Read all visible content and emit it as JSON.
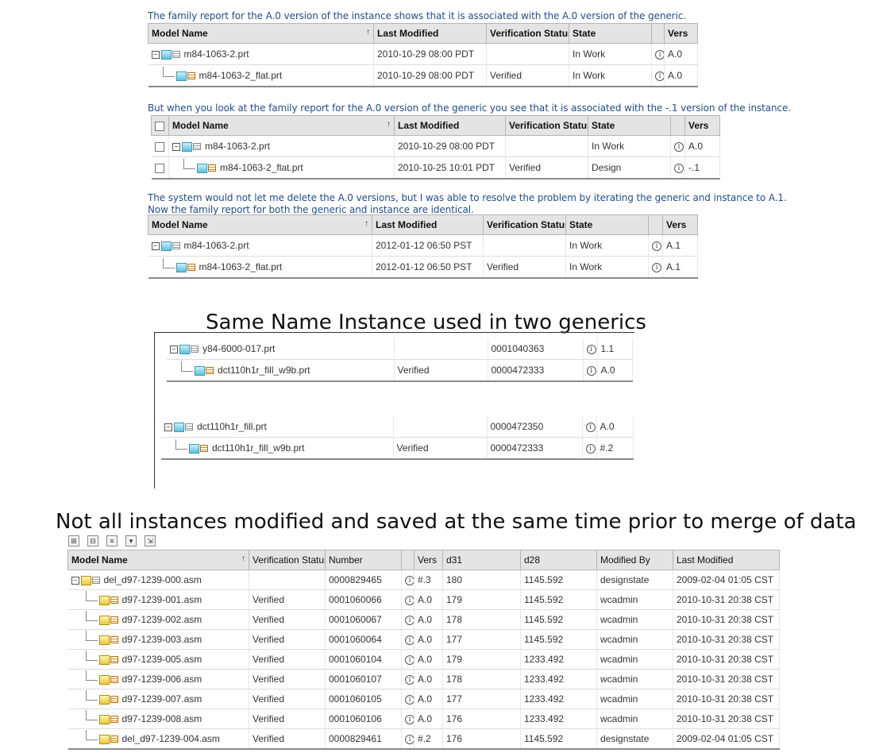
{
  "caption1": "The family report for the A.0 version of the instance shows that it is associated with the A.0 version of the generic.",
  "caption2": "But when you look at the family report for the A.0 version of the generic you see that it is associated with the -.1 version of the instance.",
  "caption3a": "The system would not let me delete the A.0 versions, but I was able to resolve the problem by iterating the generic and instance to A.1.",
  "caption3b": "Now the family report for both the generic and instance are identical.",
  "title_same_name": "Same Name Instance used in two generics",
  "title_not_all": "Not all instances modified and saved at the same time prior to merge of data",
  "columns_a": [
    "Model Name",
    "Last Modified",
    "Verification Status",
    "State",
    "",
    "Vers"
  ],
  "table1": [
    {
      "name": "m84-1063-2.prt",
      "modified": "2010-10-29 08:00 PDT",
      "verif": "",
      "state": "In Work",
      "vers": "A.0"
    },
    {
      "name": "m84-1063-2_flat.prt",
      "modified": "2010-10-29 08:00 PDT",
      "verif": "Verified",
      "state": "In Work",
      "vers": "A.0"
    }
  ],
  "table2": [
    {
      "name": "m84-1063-2.prt",
      "modified": "2010-10-29 08:00 PDT",
      "verif": "",
      "state": "In Work",
      "vers": "A.0"
    },
    {
      "name": "m84-1063-2_flat.prt",
      "modified": "2010-10-25 10:01 PDT",
      "verif": "Verified",
      "state": "Design",
      "vers": "-.1"
    }
  ],
  "table3": [
    {
      "name": "m84-1063-2.prt",
      "modified": "2012-01-12 06:50 PST",
      "verif": "",
      "state": "In Work",
      "vers": "A.1"
    },
    {
      "name": "m84-1063-2_flat.prt",
      "modified": "2012-01-12 06:50 PST",
      "verif": "Verified",
      "state": "In Work",
      "vers": "A.1"
    }
  ],
  "generic1": [
    {
      "name": "y84-6000-017.prt",
      "verif": "",
      "number": "0001040363",
      "vers": "1.1"
    },
    {
      "name": "dct110h1r_fill_w9b.prt",
      "verif": "Verified",
      "number": "0000472333",
      "vers": "A.0"
    }
  ],
  "generic2": [
    {
      "name": "dct110h1r_fill.prt",
      "verif": "",
      "number": "0000472350",
      "vers": "A.0"
    },
    {
      "name": "dct110h1r_fill_w9b.prt",
      "verif": "Verified",
      "number": "0000472333",
      "vers": "#.2"
    }
  ],
  "columns_big": [
    "Model Name",
    "Verification Status",
    "Number",
    "",
    "Vers",
    "d31",
    "d28",
    "Modified By",
    "Last Modified"
  ],
  "big_rows": [
    {
      "name": "del_d97-1239-000.asm",
      "verif": "",
      "number": "0000829465",
      "vers": "#.3",
      "d31": "180",
      "d28": "1145.592",
      "by": "designstate",
      "modified": "2009-02-04 01:05 CST"
    },
    {
      "name": "d97-1239-001.asm",
      "verif": "Verified",
      "number": "0001060066",
      "vers": "A.0",
      "d31": "179",
      "d28": "1145.592",
      "by": "wcadmin",
      "modified": "2010-10-31 20:38 CST"
    },
    {
      "name": "d97-1239-002.asm",
      "verif": "Verified",
      "number": "0001060067",
      "vers": "A.0",
      "d31": "178",
      "d28": "1145.592",
      "by": "wcadmin",
      "modified": "2010-10-31 20:38 CST"
    },
    {
      "name": "d97-1239-003.asm",
      "verif": "Verified",
      "number": "0001060064",
      "vers": "A.0",
      "d31": "177",
      "d28": "1145.592",
      "by": "wcadmin",
      "modified": "2010-10-31 20:38 CST"
    },
    {
      "name": "d97-1239-005.asm",
      "verif": "Verified",
      "number": "0001060104",
      "vers": "A.0",
      "d31": "179",
      "d28": "1233.492",
      "by": "wcadmin",
      "modified": "2010-10-31 20:38 CST"
    },
    {
      "name": "d97-1239-006.asm",
      "verif": "Verified",
      "number": "0001060107",
      "vers": "A.0",
      "d31": "178",
      "d28": "1233.492",
      "by": "wcadmin",
      "modified": "2010-10-31 20:38 CST"
    },
    {
      "name": "d97-1239-007.asm",
      "verif": "Verified",
      "number": "0001060105",
      "vers": "A.0",
      "d31": "177",
      "d28": "1233.492",
      "by": "wcadmin",
      "modified": "2010-10-31 20:38 CST"
    },
    {
      "name": "d97-1239-008.asm",
      "verif": "Verified",
      "number": "0001060106",
      "vers": "A.0",
      "d31": "176",
      "d28": "1233.492",
      "by": "wcadmin",
      "modified": "2010-10-31 20:38 CST"
    },
    {
      "name": "del_d97-1239-004.asm",
      "verif": "Verified",
      "number": "0000829461",
      "vers": "#.2",
      "d31": "176",
      "d28": "1145.592",
      "by": "designstate",
      "modified": "2009-02-04 01:05 CST"
    }
  ]
}
